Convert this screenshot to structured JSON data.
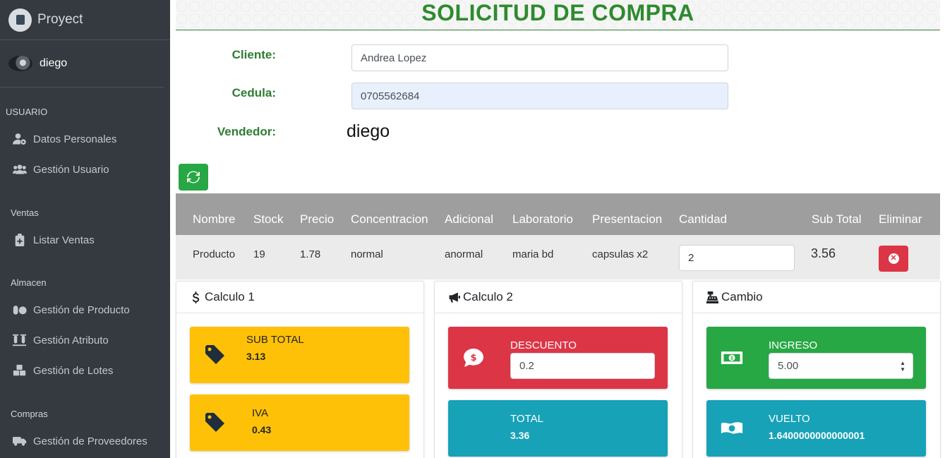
{
  "brand": {
    "name": "Proyect"
  },
  "user": {
    "name": "diego"
  },
  "sidebar": {
    "sections": [
      {
        "header": "USUARIO",
        "items": [
          {
            "label": "Datos Personales",
            "icon": "user-cog-icon"
          },
          {
            "label": "Gestión Usuario",
            "icon": "users-icon"
          }
        ]
      },
      {
        "header": "Ventas",
        "items": [
          {
            "label": "Listar Ventas",
            "icon": "clipboard-plus-icon"
          }
        ]
      },
      {
        "header": "Almacen",
        "items": [
          {
            "label": "Gestión de Producto",
            "icon": "pills-icon"
          },
          {
            "label": "Gestión Atributo",
            "icon": "vials-icon"
          },
          {
            "label": "Gestión de Lotes",
            "icon": "cubes-icon"
          }
        ]
      },
      {
        "header": "Compras",
        "items": [
          {
            "label": "Gestión de Proveedores",
            "icon": "truck-icon"
          }
        ]
      }
    ]
  },
  "page": {
    "title": "SOLICITUD DE COMPRA"
  },
  "form": {
    "cliente_label": "Cliente:",
    "cliente_value": "Andrea Lopez",
    "cedula_label": "Cedula:",
    "cedula_value": "0705562684",
    "vendedor_label": "Vendedor:",
    "vendedor_value": "diego"
  },
  "table": {
    "headers": [
      "Nombre",
      "Stock",
      "Precio",
      "Concentracion",
      "Adicional",
      "Laboratorio",
      "Presentacion",
      "Cantidad",
      "Sub Total",
      "Eliminar"
    ],
    "rows": [
      {
        "nombre": "Producto",
        "stock": "19",
        "precio": "1.78",
        "concentracion": "normal",
        "adicional": "anormal",
        "laboratorio": "maria bd",
        "presentacion": "capsulas x2",
        "cantidad": "2",
        "subtotal": "3.56"
      }
    ]
  },
  "cards": {
    "calculo1": {
      "title": "Calculo 1",
      "subtotal_label": "SUB TOTAL",
      "subtotal_value": "3.13",
      "iva_label": "IVA",
      "iva_value": "0.43"
    },
    "calculo2": {
      "title": "Calculo 2",
      "descuento_label": "DESCUENTO",
      "descuento_value": "0.2",
      "total_label": "TOTAL",
      "total_value": "3.36"
    },
    "cambio": {
      "title": "Cambio",
      "ingreso_label": "INGRESO",
      "ingreso_value": "5.00",
      "vuelto_label": "VUELTO",
      "vuelto_value": "1.6400000000000001"
    }
  },
  "colors": {
    "sidebar": "#343a40",
    "accent_green": "#2e7d32",
    "yellow": "#ffc107",
    "red": "#dc3545",
    "teal": "#17a2b8",
    "green": "#28a745"
  }
}
